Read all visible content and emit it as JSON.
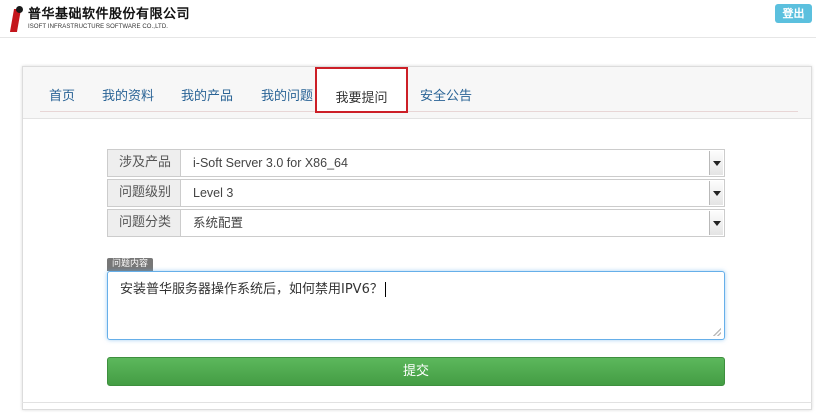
{
  "header": {
    "logo_cn": "普华基础软件股份有限公司",
    "logo_en": "ISOFT INFRASTRUCTURE SOFTWARE CO.,LTD.",
    "logout_label": "登出"
  },
  "tabs": [
    {
      "label": "首页",
      "active": false
    },
    {
      "label": "我的资料",
      "active": false
    },
    {
      "label": "我的产品",
      "active": false
    },
    {
      "label": "我的问题",
      "active": false
    },
    {
      "label": "我要提问",
      "active": true
    },
    {
      "label": "安全公告",
      "active": false
    }
  ],
  "form": {
    "product": {
      "label": "涉及产品",
      "value": "i-Soft Server 3.0 for X86_64"
    },
    "level": {
      "label": "问题级别",
      "value": "Level 3"
    },
    "category": {
      "label": "问题分类",
      "value": "系统配置"
    },
    "content_label": "问题内容",
    "content_value": "安装普华服务器操作系统后，如何禁用IPV6？",
    "submit_label": "提交"
  },
  "colors": {
    "accent_blue": "#2a6496",
    "logout_bg": "#5bc0de",
    "active_tab_border": "#cc1f27",
    "submit_bg": "#5cb85c",
    "logo_red": "#c4161c"
  }
}
